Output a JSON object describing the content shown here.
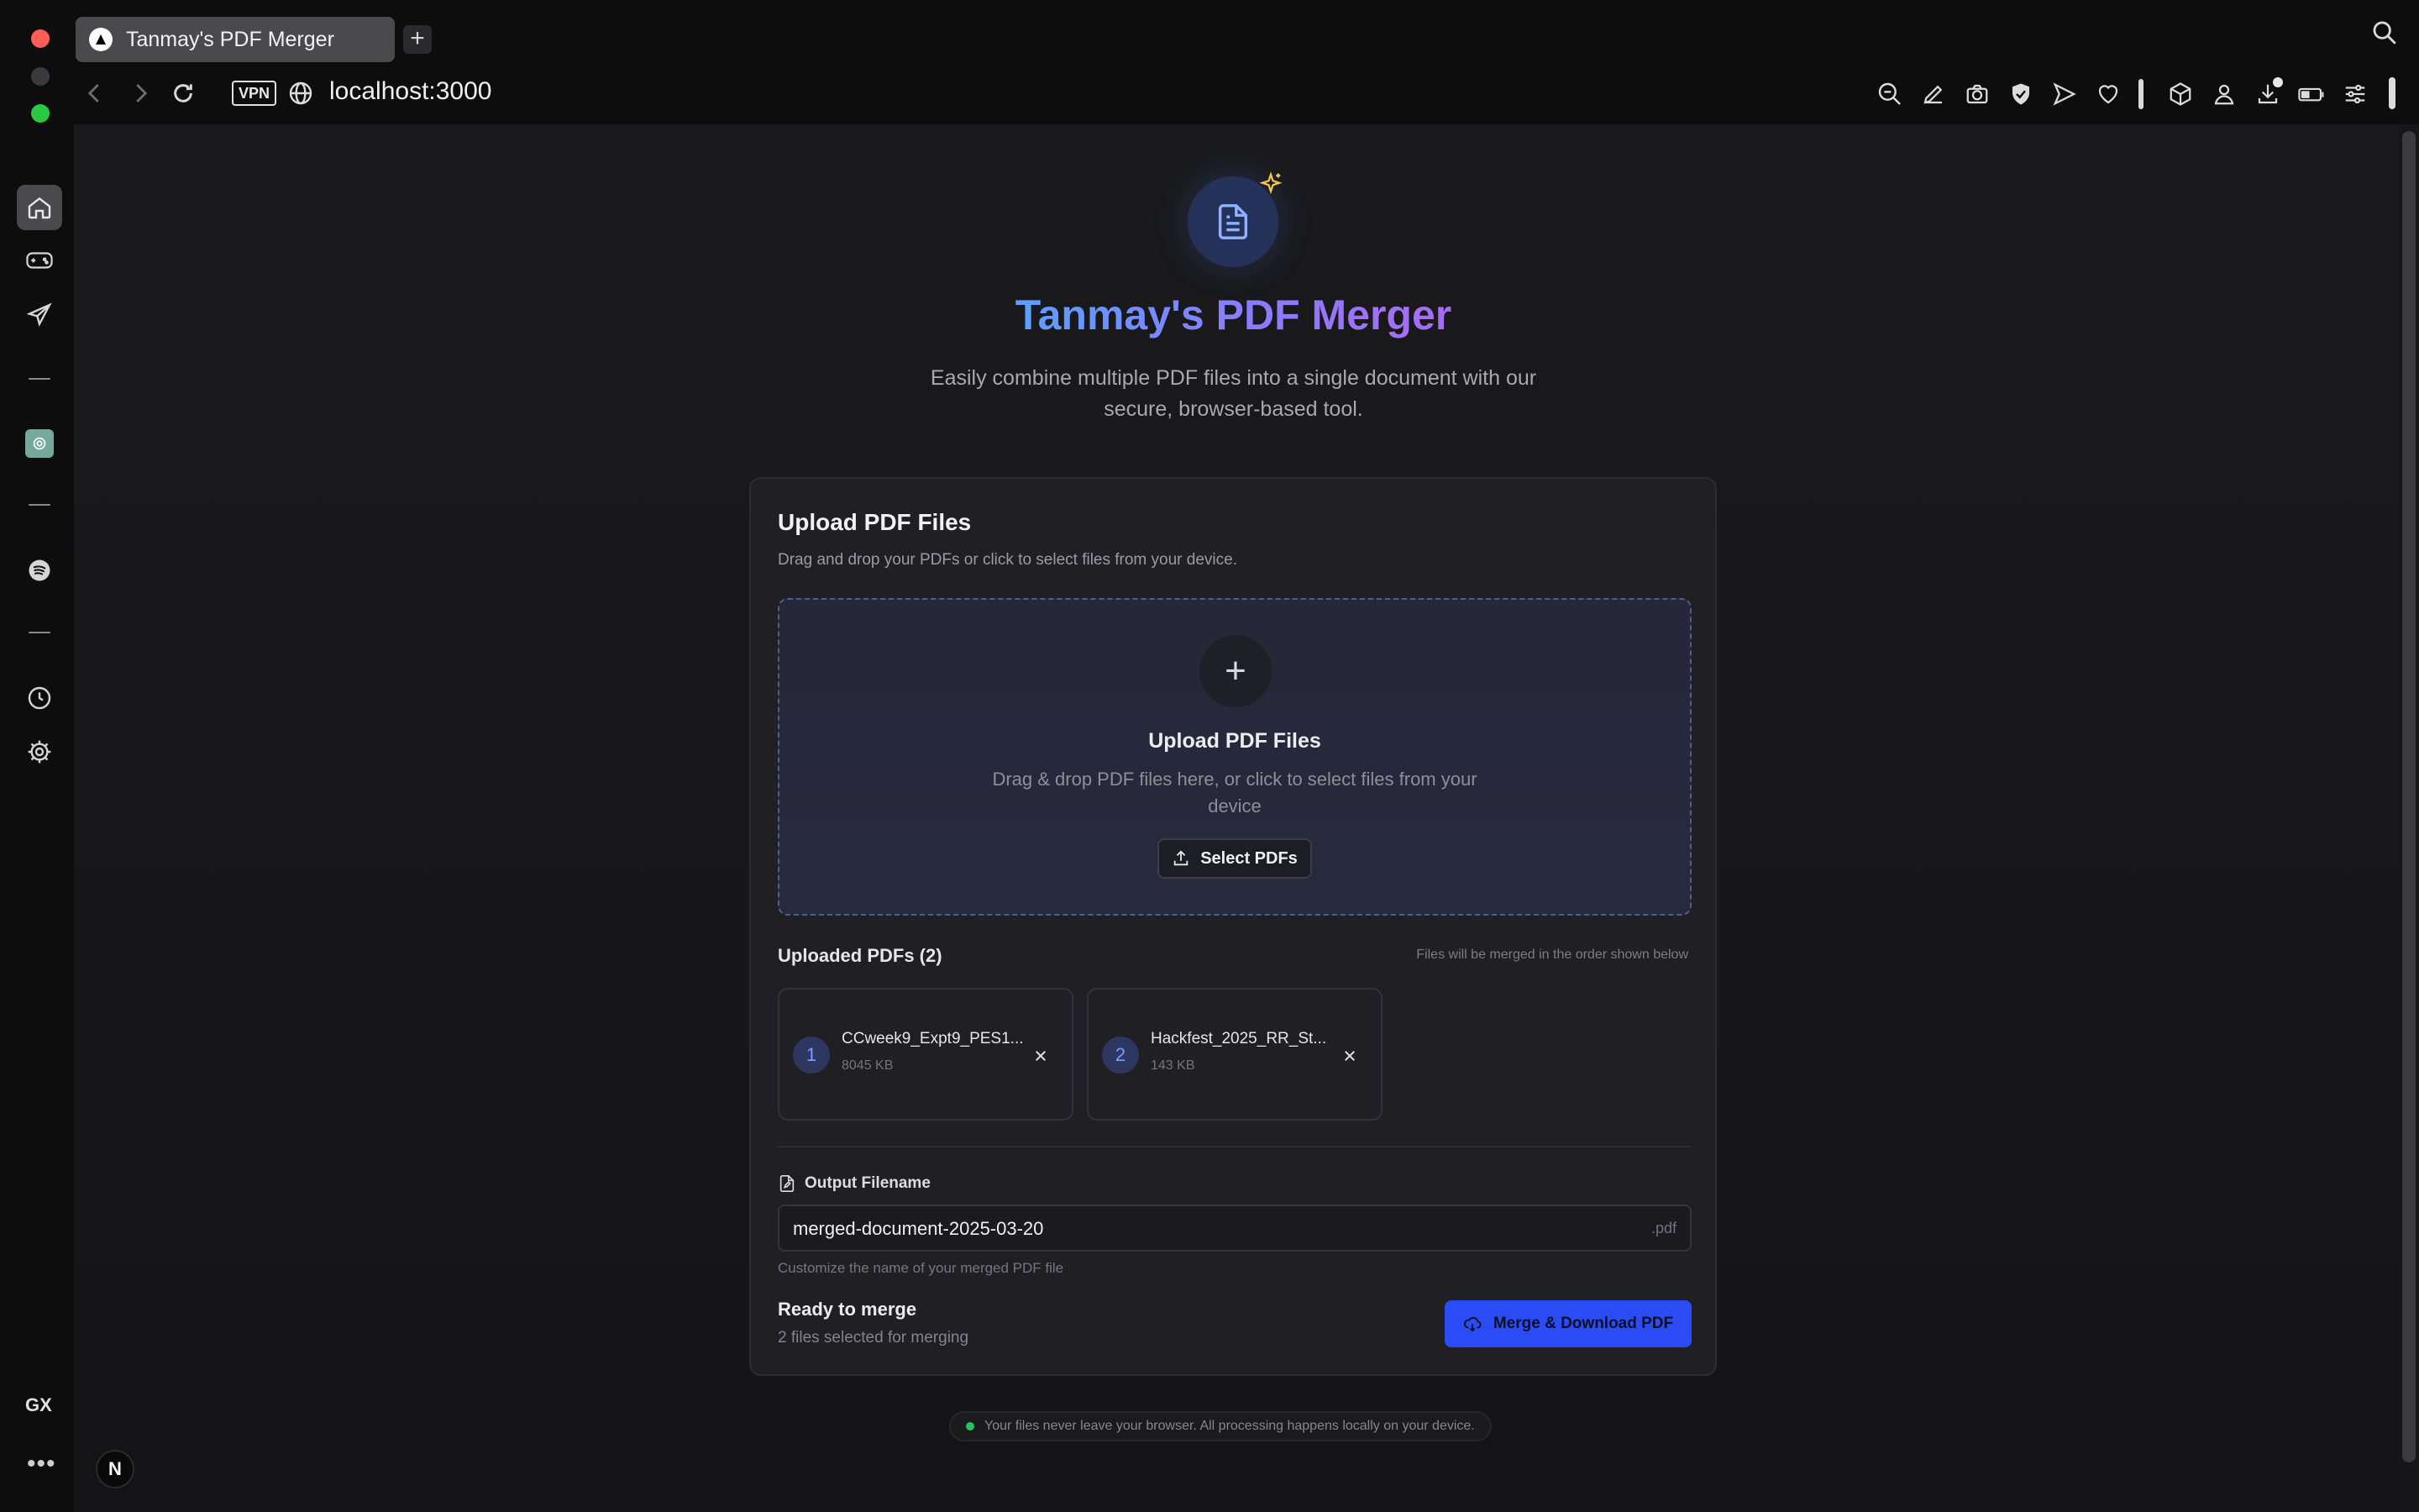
{
  "browser": {
    "tab_title": "Tanmay's PDF Merger",
    "vpn_label": "VPN",
    "url": "localhost:3000",
    "new_tab_symbol": "+",
    "toolbar_icons": [
      "zoom-out-icon",
      "pen-icon",
      "camera-icon",
      "shield-icon",
      "send-icon",
      "heart-icon",
      "cube-icon",
      "account-icon",
      "download-icon",
      "battery-icon",
      "settings-icon"
    ]
  },
  "sidebar": {
    "items": [
      "home-icon",
      "gamepad-icon",
      "airplane-icon",
      "chatgpt-icon",
      "spotify-icon",
      "clock-icon",
      "gear-icon"
    ],
    "gx_label": "GX",
    "more_label": "•••",
    "n_badge": "N"
  },
  "hero": {
    "title": "Tanmay's PDF Merger",
    "subtitle": "Easily combine multiple PDF files into a single document with our secure, browser-based tool."
  },
  "card": {
    "title": "Upload PDF Files",
    "description": "Drag and drop your PDFs or click to select files from your device.",
    "dropzone": {
      "plus": "+",
      "title": "Upload PDF Files",
      "description": "Drag & drop PDF files here, or click to select files from your device",
      "button_label": "Select PDFs"
    },
    "uploaded": {
      "title": "Uploaded PDFs (2)",
      "hint": "Files will be merged in the order shown below",
      "files": [
        {
          "index": "1",
          "name": "CCweek9_Expt9_PES1...",
          "size": "8045 KB"
        },
        {
          "index": "2",
          "name": "Hackfest_2025_RR_St...",
          "size": "143 KB"
        }
      ]
    },
    "output": {
      "label": "Output Filename",
      "value": "merged-document-2025-03-20",
      "extension": ".pdf",
      "help": "Customize the name of your merged PDF file"
    },
    "status": {
      "title": "Ready to merge",
      "subtitle": "2 files selected for merging"
    },
    "merge_button_label": "Merge & Download PDF"
  },
  "footer": {
    "note": "Your files never leave your browser. All processing happens locally on your device."
  },
  "colors": {
    "accent": "#2b4cf5",
    "title_gradient_start": "#5aa0ff",
    "title_gradient_end": "#a86cf0",
    "status_green": "#22c55e"
  }
}
